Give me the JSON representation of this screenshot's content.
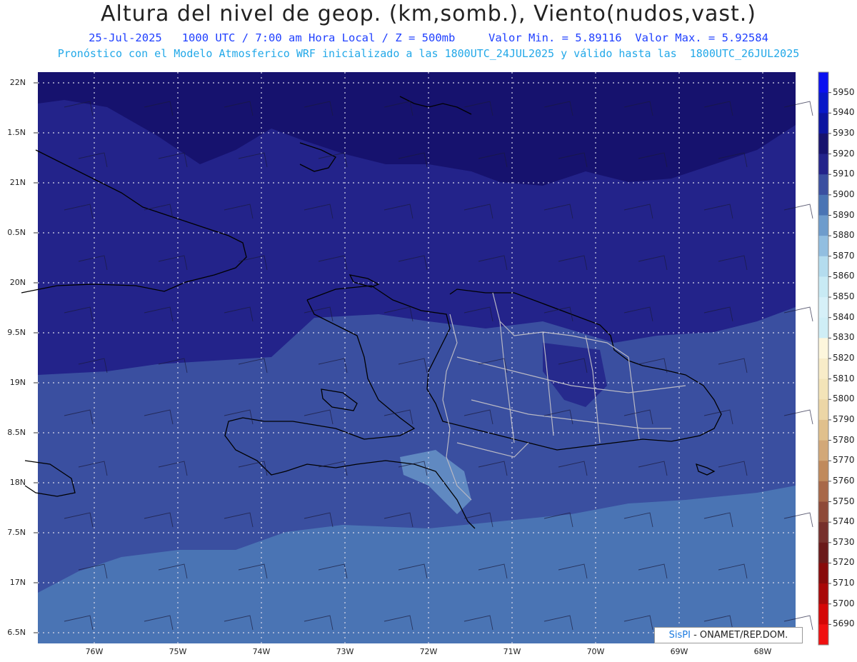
{
  "header": {
    "title": "Altura del nivel de geop. (km,somb.), Viento(nudos,vast.)",
    "line1": "25-Jul-2025   1000 UTC / 7:00 am Hora Local / Z = 500mb     Valor Min. = 5.89116  Valor Max. = 5.92584",
    "line2": "Pronóstico con el Modelo Atmosferico WRF inicializado a las 1800UTC_24JUL2025 y válido hasta las  1800UTC_26JUL2025"
  },
  "axes": {
    "lat_labels": [
      "22N",
      "1.5N",
      "21N",
      "0.5N",
      "20N",
      "9.5N",
      "19N",
      "8.5N",
      "18N",
      "7.5N",
      "17N",
      "6.5N"
    ],
    "lon_labels": [
      "76W",
      "75W",
      "74W",
      "73W",
      "72W",
      "71W",
      "70W",
      "69W",
      "68W"
    ]
  },
  "colorbar": {
    "labels": [
      "5950",
      "5940",
      "5930",
      "5920",
      "5910",
      "5900",
      "5890",
      "5880",
      "5870",
      "5860",
      "5850",
      "5840",
      "5830",
      "5820",
      "5810",
      "5800",
      "5790",
      "5780",
      "5770",
      "5760",
      "5750",
      "5740",
      "5730",
      "5720",
      "5710",
      "5700",
      "5690"
    ],
    "colors": [
      "#0a10f0",
      "#0818c8",
      "#0b14a0",
      "#16126e",
      "#23238a",
      "#3a4fa0",
      "#4a74b4",
      "#6e9ccc",
      "#92bee0",
      "#b4dcee",
      "#c8eaf4",
      "#d6f0f8",
      "#cfeef6",
      "#fdf6dc",
      "#f8ecc8",
      "#f3e4b8",
      "#ecd6a6",
      "#e0c08c",
      "#d2a878",
      "#c08a5c",
      "#a86848",
      "#8e4a38",
      "#76302c",
      "#6a1a1a",
      "#880a0a",
      "#a80808",
      "#d40606",
      "#f01010"
    ]
  },
  "legend_colors": {
    "level_5920": "#16126e",
    "level_5910": "#23238a",
    "level_5900": "#3a4fa0",
    "level_5890": "#4a74b4",
    "level_5880": "#6e9ccc"
  },
  "credit": {
    "brand": "SisPI",
    "text": "- ONAMET/REP.DOM."
  }
}
